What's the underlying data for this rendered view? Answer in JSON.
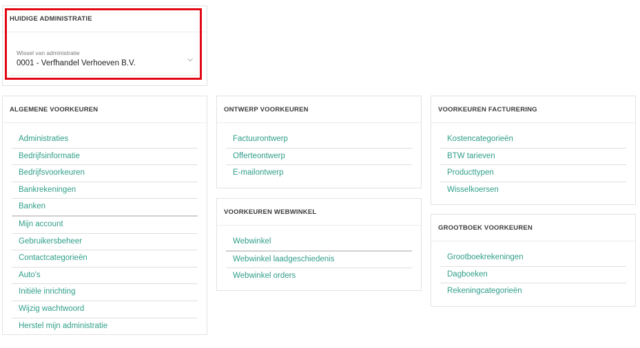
{
  "current_admin": {
    "title": "HUIDIGE ADMINISTRATIE",
    "select_label": "Wissel van administratie",
    "select_value": "0001 - Verfhandel Verhoeven B.V."
  },
  "algemene": {
    "title": "ALGEMENE VOORKEUREN",
    "items": [
      "Administraties",
      "Bedrijfsinformatie",
      "Bedrijfsvoorkeuren",
      "Bankrekeningen",
      "Banken",
      "Mijn account",
      "Gebruikersbeheer",
      "Contactcategorieën",
      "Auto's",
      "Initiële inrichting",
      "Wijzig wachtwoord",
      "Herstel mijn administratie"
    ]
  },
  "ontwerp": {
    "title": "ONTWERP VOORKEUREN",
    "items": [
      "Factuurontwerp",
      "Offerteontwerp",
      "E-mailontwerp"
    ]
  },
  "webwinkel": {
    "title": "VOORKEUREN WEBWINKEL",
    "items": [
      "Webwinkel",
      "Webwinkel laadgeschiedenis",
      "Webwinkel orders"
    ]
  },
  "facturering": {
    "title": "VOORKEUREN FACTURERING",
    "items": [
      "Kostencategorieën",
      "BTW tarieven",
      "Producttypen",
      "Wisselkoersen"
    ]
  },
  "grootboek": {
    "title": "GROOTBOEK VOORKEUREN",
    "items": [
      "Grootboekrekeningen",
      "Dagboeken",
      "Rekeningcategorieën"
    ]
  },
  "colors": {
    "link": "#2f9e8a",
    "highlight": "#e30613"
  }
}
